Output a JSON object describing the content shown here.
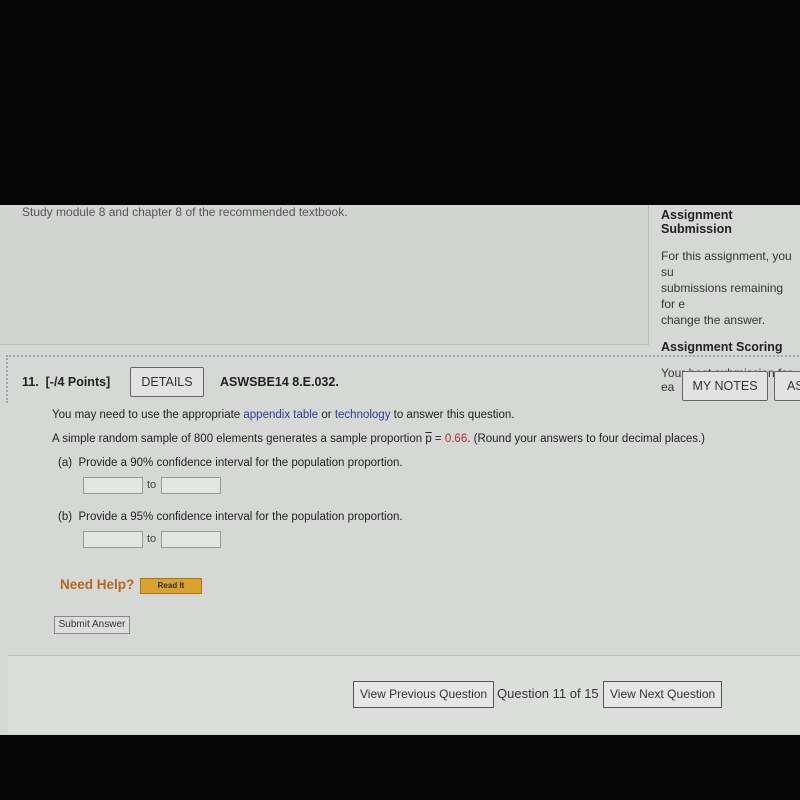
{
  "intro": {
    "text": "Study module 8 and chapter 8 of the recommended textbook."
  },
  "sidebar": {
    "submission_heading": "Assignment Submission",
    "submission_lines": [
      "For this assignment, you su",
      "submissions remaining for e",
      "change the answer."
    ],
    "scoring_heading": "Assignment Scoring",
    "scoring_text": "Your best submission for ea"
  },
  "question": {
    "number": "11.",
    "points": "[-/4 Points]",
    "details_label": "DETAILS",
    "code": "ASWSBE14 8.E.032.",
    "my_notes_label": "MY NOTES",
    "ask_label": "AS",
    "note_pre": "You may need to use the appropriate ",
    "link1": "appendix table",
    "note_mid": " or ",
    "link2": "technology",
    "note_post": " to answer this question.",
    "stem_pre": "A simple random sample of 800 elements generates a sample proportion ",
    "pbar": "p",
    "stem_eq": " = ",
    "pvalue": "0.66",
    "stem_post": ". (Round your answers to four decimal places.)",
    "parts": [
      {
        "label": "(a)",
        "text": "Provide a 90% confidence interval for the population proportion.",
        "lower": "",
        "upper": "",
        "to": "to"
      },
      {
        "label": "(b)",
        "text": "Provide a 95% confidence interval for the population proportion.",
        "lower": "",
        "upper": "",
        "to": "to"
      }
    ],
    "need_help": "Need Help?",
    "read_it": "Read It",
    "submit_label": "Submit Answer"
  },
  "nav": {
    "prev": "View Previous Question",
    "position": "Question 11 of 15",
    "next": "View Next Question"
  }
}
